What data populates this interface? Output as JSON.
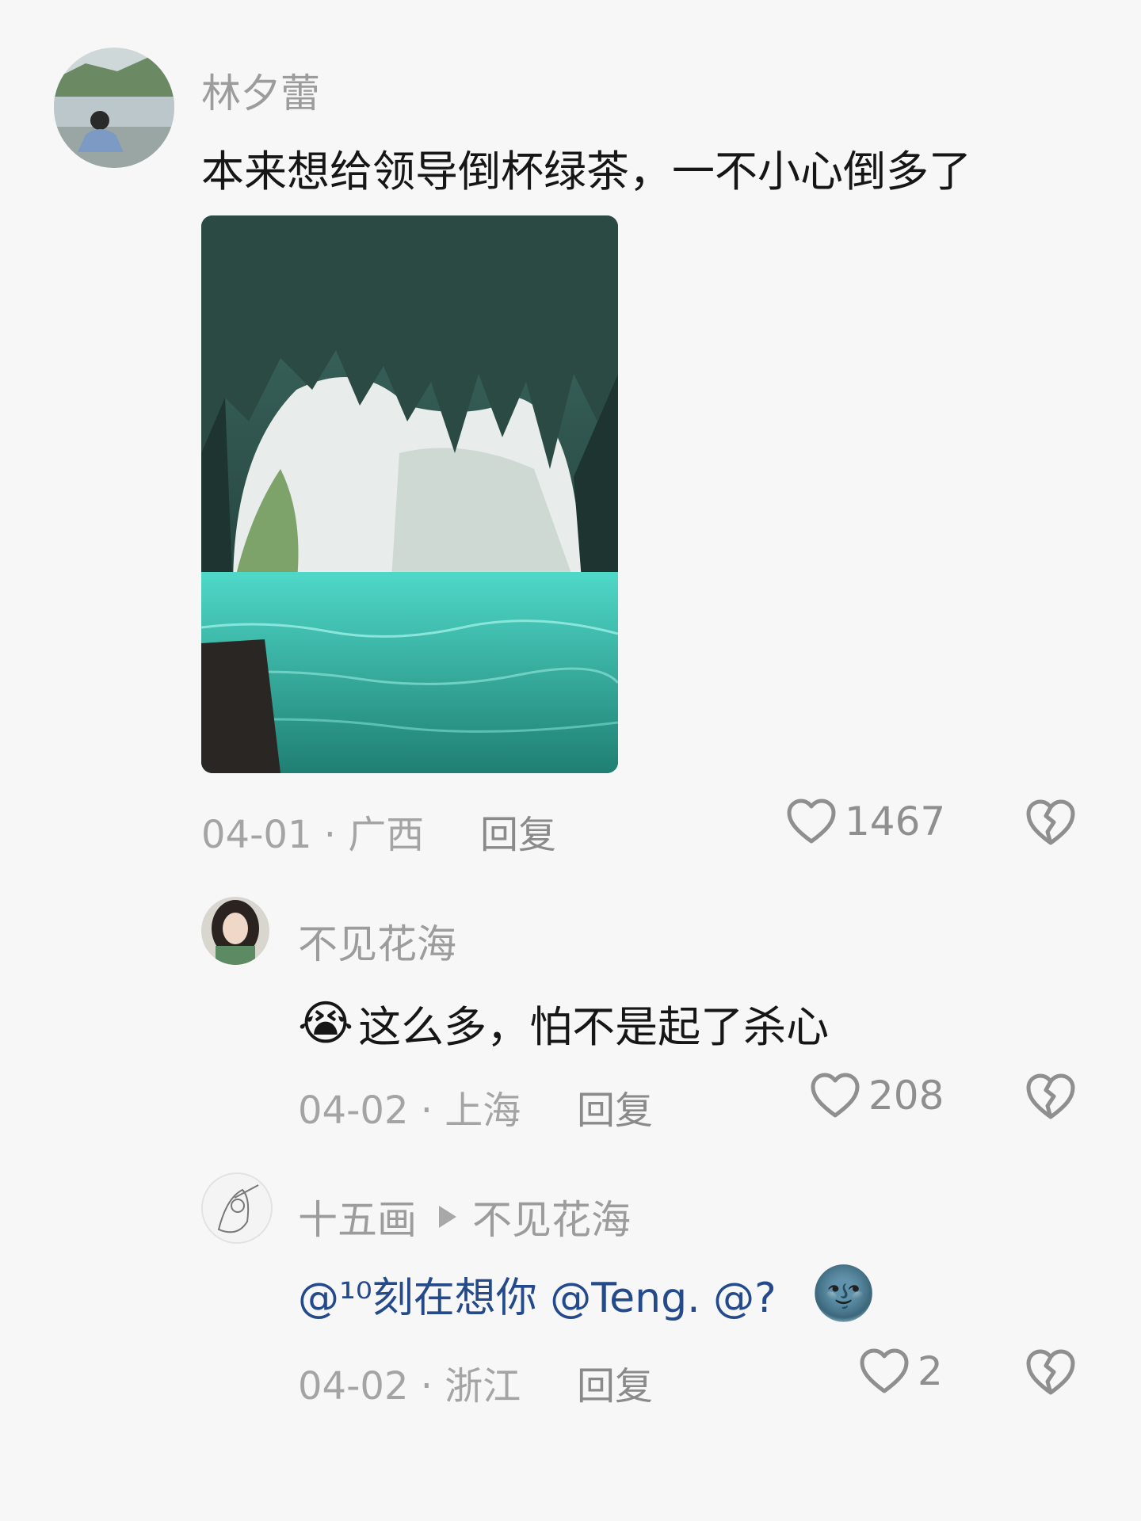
{
  "comments": [
    {
      "username": "林夕蕾",
      "text": "本来想给领导倒杯绿茶，一不小心倒多了",
      "date_location": "04-01 · 广西",
      "reply_label": "回复",
      "likes": "1467"
    },
    {
      "username": "不见花海",
      "emoji": "😭",
      "text": "这么多，怕不是起了杀心",
      "date_location": "04-02 · 上海",
      "reply_label": "回复",
      "likes": "208"
    },
    {
      "username": "十五画",
      "reply_to": "不见花海",
      "mentions": "@¹⁰刻在想你 @Teng. @?",
      "emoji": "🌚",
      "date_location": "04-02 · 浙江",
      "reply_label": "回复",
      "likes": "2"
    }
  ],
  "icons": {
    "like": "heart-outline-icon",
    "dislike": "broken-heart-icon"
  },
  "colors": {
    "water": "#3cc4b4",
    "cave": "#1d3b36"
  }
}
